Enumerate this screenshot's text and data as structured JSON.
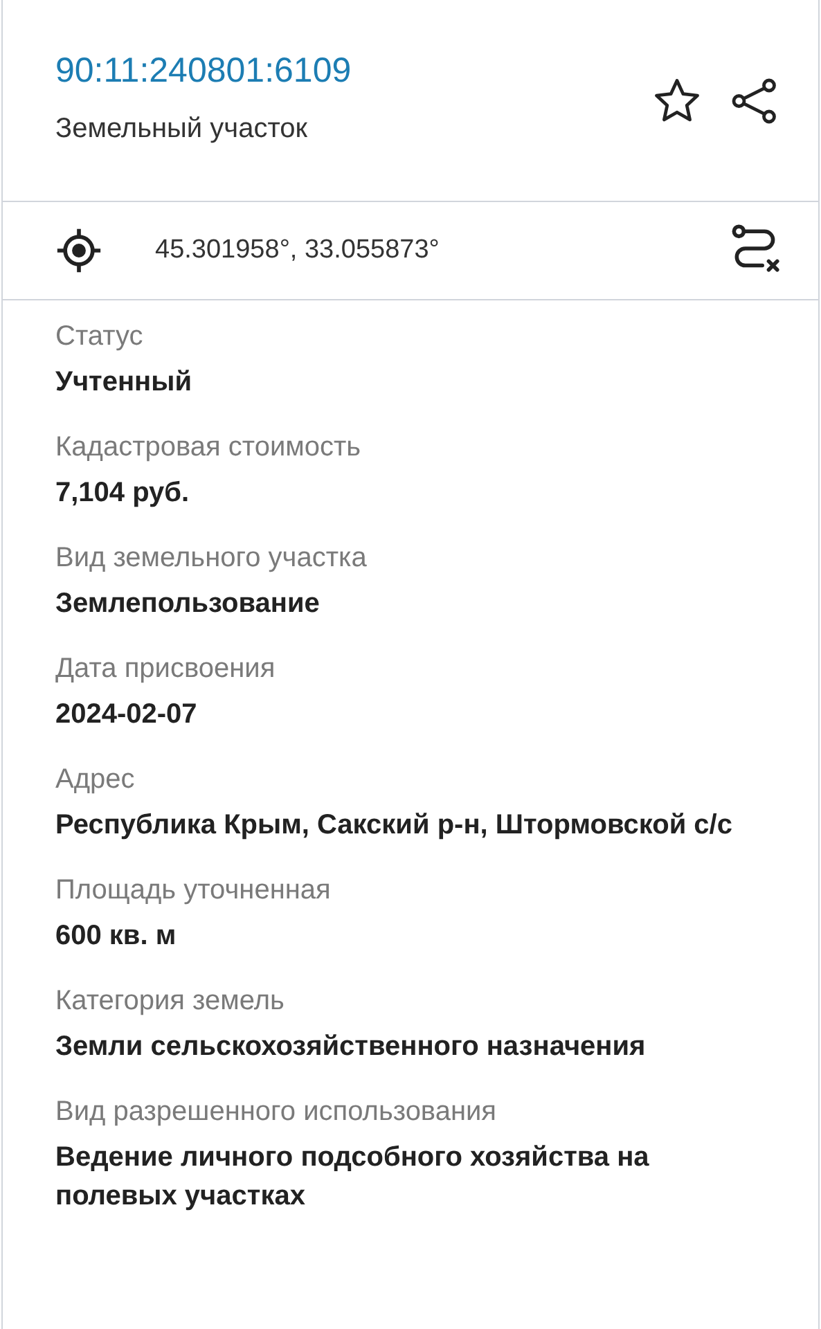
{
  "header": {
    "cadastral_number": "90:11:240801:6109",
    "object_type": "Земельный участок"
  },
  "coordinates": "45.301958°, 33.055873°",
  "fields": [
    {
      "label": "Статус",
      "value": "Учтенный"
    },
    {
      "label": "Кадастровая стоимость",
      "value": "7,104 руб."
    },
    {
      "label": "Вид земельного участка",
      "value": "Землепользование"
    },
    {
      "label": "Дата присвоения",
      "value": "2024-02-07"
    },
    {
      "label": "Адрес",
      "value": "Республика Крым, Сакский р-н, Штормовской с/с"
    },
    {
      "label": "Площадь уточненная",
      "value": "600 кв. м"
    },
    {
      "label": "Категория земель",
      "value": "Земли сельскохозяйственного назначения"
    },
    {
      "label": "Вид разрешенного использования",
      "value": "Ведение личного подсобного хозяйства на полевых участках"
    }
  ]
}
